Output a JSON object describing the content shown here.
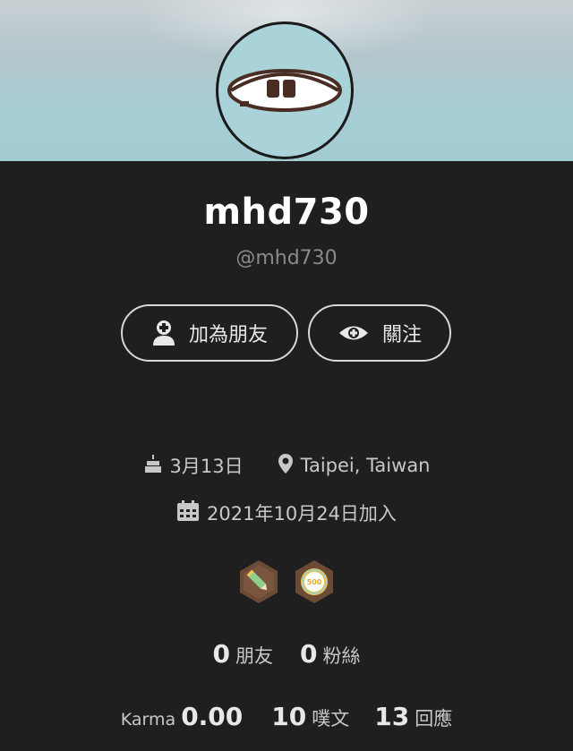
{
  "profile": {
    "display_name": "mhd730",
    "handle": "@mhd730"
  },
  "actions": {
    "add_friend_label": "加為朋友",
    "follow_label": "關注"
  },
  "details": {
    "birthday": "3月13日",
    "location": "Taipei, Taiwan",
    "joined": "2021年10月24日加入"
  },
  "badges": [
    {
      "name": "pencil-badge",
      "text": ""
    },
    {
      "name": "500-badge",
      "text": "500"
    }
  ],
  "stats": {
    "friends_count": "0",
    "friends_label": "朋友",
    "fans_count": "0",
    "fans_label": "粉絲",
    "karma_label": "Karma",
    "karma_value": "0.00",
    "plurks_count": "10",
    "plurks_label": "噗文",
    "replies_count": "13",
    "replies_label": "回應"
  },
  "colors": {
    "background": "#1f1f1f",
    "cover": "#a6cdd4",
    "avatar_bg": "#a9d2d9",
    "badge_brown": "#6b4a36",
    "badge_green": "#8ed08b",
    "badge_gold": "#f4c64a"
  }
}
